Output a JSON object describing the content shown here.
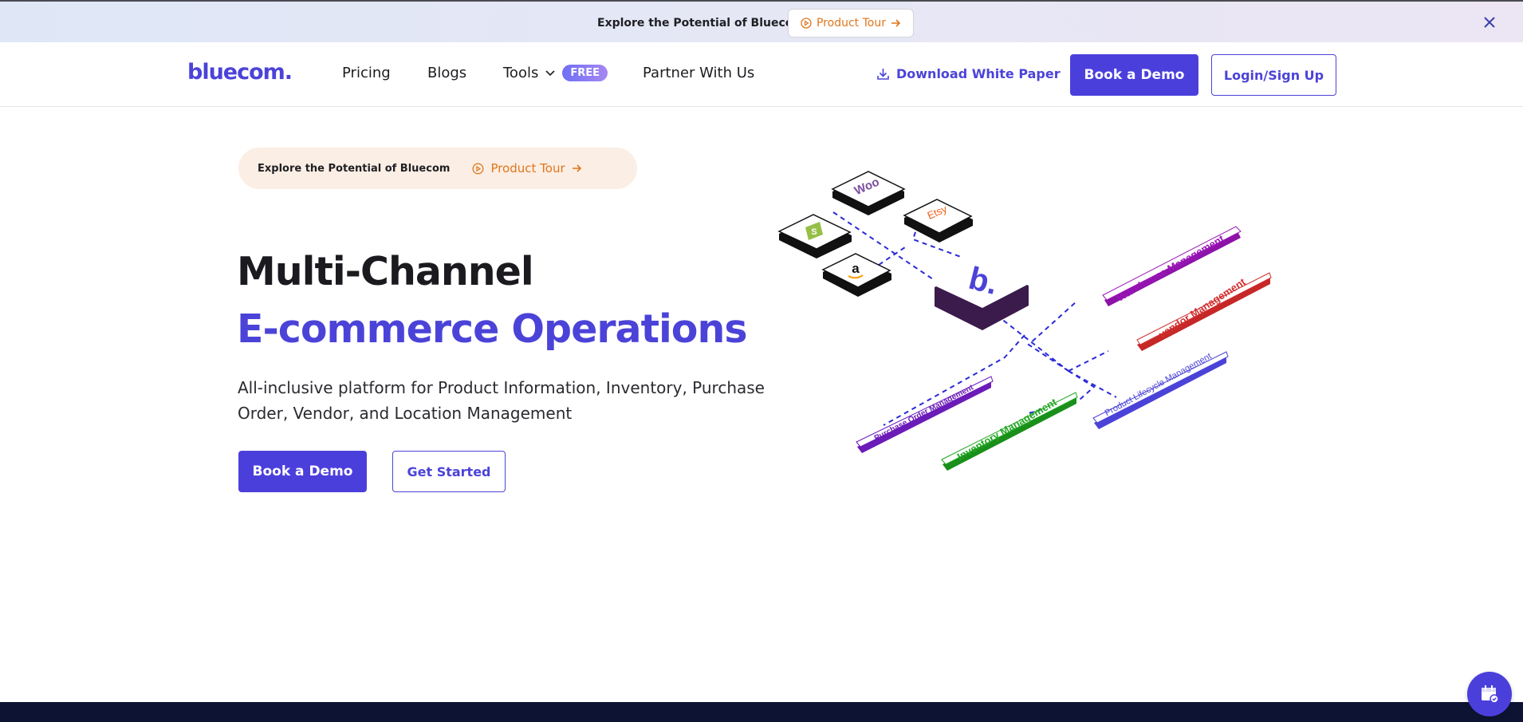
{
  "announcement": {
    "text": "Explore the Potential of Bluecom",
    "tour_label": "Product Tour"
  },
  "nav": {
    "logo": "bluecom.",
    "pricing": "Pricing",
    "blogs": "Blogs",
    "tools": "Tools",
    "free_badge": "FREE",
    "partner": "Partner With Us",
    "download": "Download White Paper",
    "demo": "Book a Demo",
    "login": "Login/Sign Up"
  },
  "hero": {
    "pill_text": "Explore the Potential of Bluecom",
    "pill_tour": "Product Tour",
    "title_line1": "Multi-Channel",
    "title_line2": "E-commerce Operations",
    "subtitle": "All-inclusive platform for Product Information, Inventory, Purchase Order, Vendor, and Location Management",
    "demo_button": "Book a Demo",
    "start_button": "Get Started"
  },
  "illustration": {
    "hub_label": "b.",
    "channels": {
      "woo": "Woo",
      "etsy": "Etsy",
      "shopify": "S",
      "amazon": "a"
    },
    "modules": {
      "warehouse": "Warehouse Management",
      "vendor": "vendor Management",
      "lifecycle": "Product Lifecycle Management",
      "purchase": "Purchase Order Management",
      "inventory": "Inventory Management"
    }
  },
  "colors": {
    "brand": "#4b43d8",
    "accent_orange": "#e0761d",
    "footer": "#0d1433"
  }
}
